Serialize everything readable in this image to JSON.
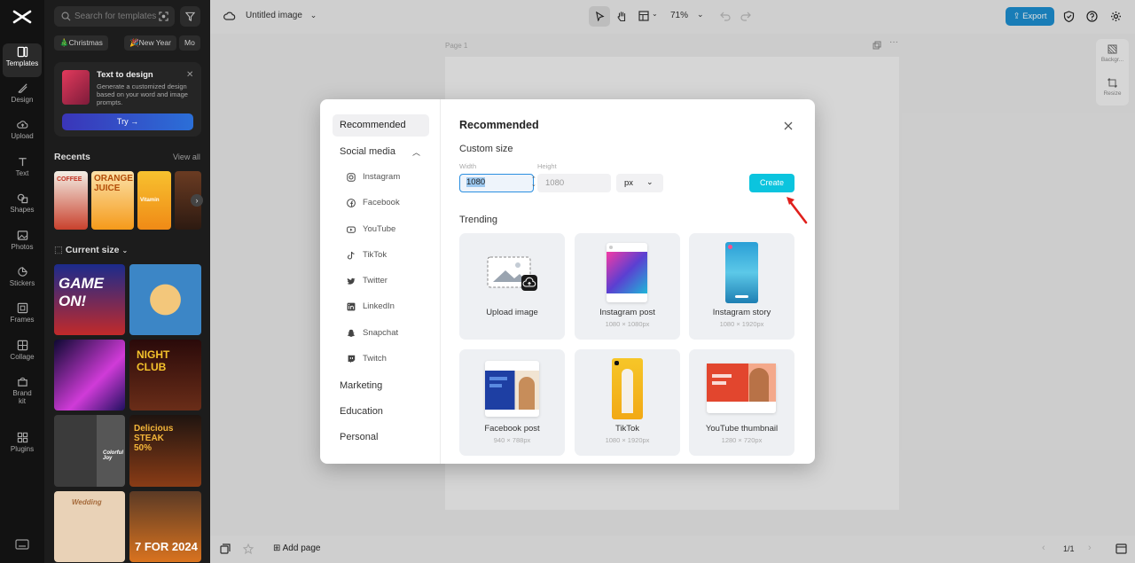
{
  "rail": {
    "items": [
      {
        "label": "Templates",
        "icon": "templates-icon"
      },
      {
        "label": "Design",
        "icon": "design-icon"
      },
      {
        "label": "Upload",
        "icon": "upload-icon"
      },
      {
        "label": "Text",
        "icon": "text-icon"
      },
      {
        "label": "Shapes",
        "icon": "shapes-icon"
      },
      {
        "label": "Photos",
        "icon": "photos-icon"
      },
      {
        "label": "Stickers",
        "icon": "stickers-icon"
      },
      {
        "label": "Frames",
        "icon": "frames-icon"
      },
      {
        "label": "Collage",
        "icon": "collage-icon"
      },
      {
        "label": "Brand kit",
        "icon": "brand-kit-icon"
      },
      {
        "label": "Plugins",
        "icon": "plugins-icon"
      }
    ]
  },
  "panel": {
    "search_placeholder": "Search for templates",
    "chips": [
      "🎄Christmas",
      "🎉New Year",
      "Mo"
    ],
    "promo": {
      "title": "Text to design",
      "description": "Generate a customized design based on your word and image prompts.",
      "try_label": "Try →"
    },
    "recents_title": "Recents",
    "view_all": "View all",
    "recent_tiles": [
      "COFFEE",
      "ORANGE JUICE",
      "Vitamin",
      ""
    ],
    "current_size_title": "Current size",
    "grid_tiles": [
      "GAME ON!",
      "",
      "",
      "NIGHT CLUB",
      "Colorful Joy",
      "Delicious STEAK 50%",
      "Wedding",
      "7 FOR 2024"
    ]
  },
  "topbar": {
    "doc_title": "Untitled image",
    "zoom": "71%",
    "export_label": "Export"
  },
  "canvas": {
    "page_label": "Page 1",
    "side_tools": [
      "Backgr...",
      "Resize"
    ]
  },
  "bottombar": {
    "add_page": "Add page",
    "page_counter": "1/1"
  },
  "modal": {
    "nav": {
      "recommended": "Recommended",
      "social_media": "Social media",
      "social_items": [
        {
          "label": "Instagram",
          "icon": "instagram-icon"
        },
        {
          "label": "Facebook",
          "icon": "facebook-icon"
        },
        {
          "label": "YouTube",
          "icon": "youtube-icon"
        },
        {
          "label": "TikTok",
          "icon": "tiktok-icon"
        },
        {
          "label": "Twitter",
          "icon": "twitter-icon"
        },
        {
          "label": "LinkedIn",
          "icon": "linkedin-icon"
        },
        {
          "label": "Snapchat",
          "icon": "snapchat-icon"
        },
        {
          "label": "Twitch",
          "icon": "twitch-icon"
        }
      ],
      "marketing": "Marketing",
      "education": "Education",
      "personal": "Personal"
    },
    "title": "Recommended",
    "custom_size": "Custom size",
    "width_label": "Width",
    "height_label": "Height",
    "width_value": "1080",
    "height_value": "1080",
    "unit": "px",
    "create_label": "Create",
    "trending": "Trending",
    "cards": [
      {
        "name": "Upload image",
        "size": ""
      },
      {
        "name": "Instagram post",
        "size": "1080 × 1080px"
      },
      {
        "name": "Instagram story",
        "size": "1080 × 1920px"
      },
      {
        "name": "Facebook post",
        "size": "940 × 788px"
      },
      {
        "name": "TikTok",
        "size": "1080 × 1920px"
      },
      {
        "name": "YouTube thumbnail",
        "size": "1280 × 720px"
      }
    ]
  },
  "colors": {
    "accent": "#0bc4de",
    "export": "#1d8fd1",
    "focus": "#2b8fe0",
    "arrow": "#e0201c"
  }
}
